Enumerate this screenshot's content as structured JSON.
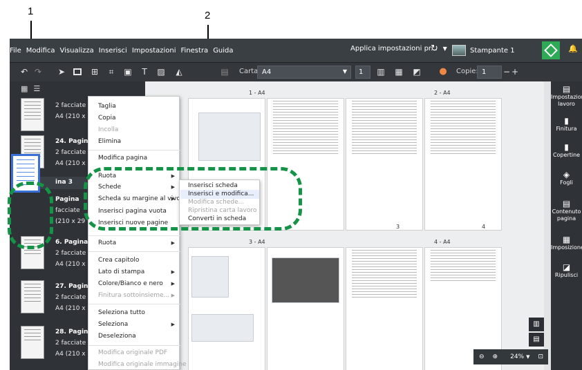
{
  "callouts": [
    "1",
    "2"
  ],
  "menubar": {
    "items": [
      "File",
      "Modifica",
      "Visualizza",
      "Inserisci",
      "Impostazioni",
      "Finestra",
      "Guida"
    ],
    "apply_label": "Applica impostazioni pr...",
    "printer_label": "Stampante 1"
  },
  "toolbar": {
    "paper_label": "Carta:",
    "paper_value": "A4",
    "page_count": "1",
    "copies_label": "Copie:",
    "copies_value": "1",
    "minus": "−",
    "plus": "+"
  },
  "left_panel": {
    "pages": [
      {
        "title": "",
        "line1": "2 facciate |",
        "line2": "A4 (210 x 29"
      },
      {
        "title": "24. Pagina",
        "line1": "2 facciate |",
        "line2": "A4 (210 x 29"
      },
      {
        "title": "ina 3",
        "line1": "",
        "line2": ""
      },
      {
        "title": "Pagina",
        "line1": "facciate",
        "line2": "(210 x 29"
      },
      {
        "title": "6. Pagina",
        "line1": "2 facciate |",
        "line2": "A4 (210 x 29"
      },
      {
        "title": "27. Pagina",
        "line1": "2 facciate |",
        "line2": "A4 (210 x 29"
      },
      {
        "title": "28. Pagina",
        "line1": "2 facciate |",
        "line2": "A4 (210 x 29"
      }
    ]
  },
  "workspace": {
    "page_labels": [
      "1 - A4",
      "2 - A4",
      "3 - A4",
      "4 - A4"
    ],
    "page_numbers": [
      "3",
      "4"
    ],
    "zoom": "24%"
  },
  "right_panel": {
    "items": [
      "Impostazioni lavoro",
      "Finitura",
      "Copertine",
      "Fogli",
      "Contenuto pagina",
      "Imposizione",
      "Ripulisci"
    ]
  },
  "context_menu": {
    "items": [
      {
        "label": "Taglia",
        "disabled": false
      },
      {
        "label": "Copia",
        "disabled": false
      },
      {
        "label": "Incolla",
        "disabled": true
      },
      {
        "label": "Elimina",
        "disabled": false
      },
      {
        "label": "Modifica pagina",
        "disabled": false
      },
      {
        "label": "Ruota",
        "disabled": false
      },
      {
        "label": "Schede",
        "disabled": false
      },
      {
        "label": "Scheda su margine al vivo",
        "disabled": false
      },
      {
        "label": "Inserisci pagina vuota",
        "disabled": false
      },
      {
        "label": "Inserisci nuove pagine",
        "disabled": false
      },
      {
        "label": "Ruota",
        "disabled": false
      },
      {
        "label": "Crea capitolo",
        "disabled": false
      },
      {
        "label": "Lato di stampa",
        "disabled": false
      },
      {
        "label": "Colore/Bianco e nero",
        "disabled": false
      },
      {
        "label": "Finitura sottoinsieme...",
        "disabled": true
      },
      {
        "label": "Seleziona tutto",
        "disabled": false
      },
      {
        "label": "Seleziona",
        "disabled": false
      },
      {
        "label": "Deseleziona",
        "disabled": false
      },
      {
        "label": "Modifica originale PDF",
        "disabled": true
      },
      {
        "label": "Modifica originale immagine",
        "disabled": true
      }
    ]
  },
  "sub_menu": {
    "items": [
      {
        "label": "Inserisci scheda",
        "disabled": false
      },
      {
        "label": "Inserisci e modifica...",
        "disabled": false
      },
      {
        "label": "Modifica schede...",
        "disabled": true
      },
      {
        "label": "Ripristina carta lavoro",
        "disabled": true
      },
      {
        "label": "Converti in scheda",
        "disabled": false
      }
    ]
  },
  "colors": {
    "callout_green": "#159447",
    "selection_blue": "#3a6fd8",
    "send_button": "#2eaa56"
  }
}
